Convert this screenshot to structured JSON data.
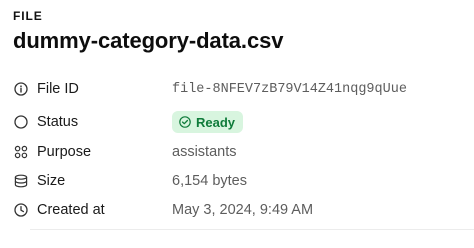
{
  "header": {
    "section_label": "FILE",
    "title": "dummy-category-data.csv"
  },
  "rows": [
    {
      "label": "File ID",
      "value": "file-8NFEV7zB79V14Z41nqg9qUue",
      "icon": "info-circle-icon"
    },
    {
      "label": "Status",
      "value": "Ready",
      "icon": "circle-outline-icon",
      "badge_icon": "check-circle-icon"
    },
    {
      "label": "Purpose",
      "value": "assistants",
      "icon": "grid-dots-icon"
    },
    {
      "label": "Size",
      "value": "6,154 bytes",
      "icon": "database-stack-icon"
    },
    {
      "label": "Created at",
      "value": "May 3, 2024, 9:49 AM",
      "icon": "clock-icon"
    }
  ],
  "colors": {
    "ready_badge_bg": "#d8f5df",
    "ready_badge_text": "#0f7b3a",
    "value_text": "#5d5d5d"
  }
}
